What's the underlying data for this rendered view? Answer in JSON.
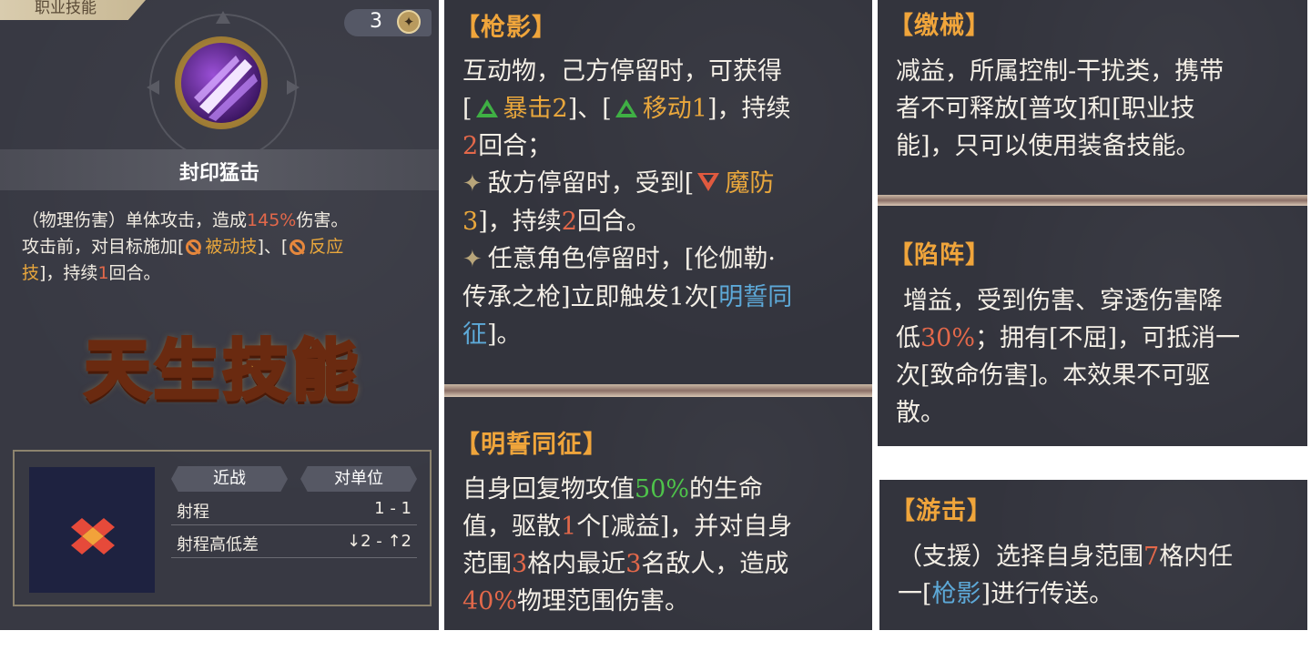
{
  "left": {
    "header_tab": "职业技能",
    "cost": "3",
    "skill_name": "封印猛击",
    "desc_line1_a": "（物理伤害）单体攻击，造成",
    "desc_line1_pct": "145%",
    "desc_line1_b": "伤害。",
    "desc_line2_a": "攻击前，对目标施加[",
    "tag_passive": "被动技",
    "desc_line2_b": "]、[",
    "tag_react_a": "反应",
    "tag_react_b": "技",
    "desc_line3_a": "]，持续",
    "desc_line3_num": "1",
    "desc_line3_b": "回合。",
    "innate_banner": "天生技能",
    "range_type": "近战",
    "target_type": "对单位",
    "range_label": "射程",
    "range_value": "1 - 1",
    "height_label": "射程高低差",
    "height_value": "↓2 - ↑2"
  },
  "qiangying": {
    "title": "【枪影】",
    "l1": "互动物，己方停留时，可获得",
    "l2_a": "[",
    "l2_crit": "暴击2",
    "l2_b": "]、[",
    "l2_move": "移动1",
    "l2_c": "]，持续",
    "l3_num": "2",
    "l3_b": "回合；",
    "l4_a": "敌方停留时，受到[",
    "l4_mdef": "魔防",
    "l5_num": "3",
    "l5_b": "]，持续",
    "l5_num2": "2",
    "l5_c": "回合。",
    "l6": "任意角色停留时，[伦伽勒·",
    "l7_a": "传承之枪]立即触发1次[",
    "l7_link": "明誓同",
    "l8_link": "征",
    "l8_b": "]。"
  },
  "mingshi": {
    "title": "【明誓同征】",
    "l1_a": "自身回复物攻值",
    "l1_pct": "50%",
    "l1_b": "的生命",
    "l2_a": "值，驱散",
    "l2_num": "1",
    "l2_b": "个[减益]，并对自身",
    "l3_a": "范围",
    "l3_num": "3",
    "l3_b": "格内最近",
    "l3_num2": "3",
    "l3_c": "名敌人，造成",
    "l4_pct": "40%",
    "l4_b": "物理范围伤害。"
  },
  "jiaoxie": {
    "title": "【缴械】",
    "l1": "减益，所属控制-干扰类，携带",
    "l2": "者不可释放[普攻]和[职业技",
    "l3": "能]，只可以使用装备技能。"
  },
  "xianzhen": {
    "title": "【陷阵】",
    "l1": "增益，受到伤害、穿透伤害降",
    "l2_a": "低",
    "l2_pct": "30%",
    "l2_b": "；拥有[不屈]，可抵消一",
    "l3": "次[致命伤害]。本效果不可驱",
    "l4": "散。"
  },
  "youji": {
    "title": "【游击】",
    "l1_a": "（支援）选择自身范围",
    "l1_num": "7",
    "l1_b": "格内任",
    "l2_a": "一[",
    "l2_link": "枪影",
    "l2_b": "]进行传送。"
  }
}
